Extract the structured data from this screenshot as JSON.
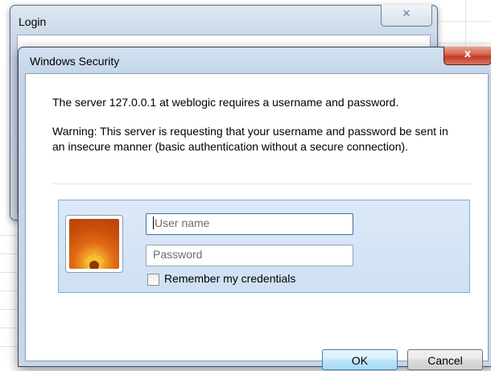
{
  "login_window": {
    "title": "Login",
    "close_glyph": "✕"
  },
  "security_dialog": {
    "title": "Windows Security",
    "close_glyph": "x",
    "message": "The server 127.0.0.1 at weblogic requires a username and password.",
    "warning": "Warning: This server is requesting that your username and password be sent in an insecure manner (basic authentication without a secure connection).",
    "credentials": {
      "avatar_icon": "user-tile-flower-icon",
      "username": {
        "value": "",
        "placeholder": "User name"
      },
      "password": {
        "value": "",
        "placeholder": "Password"
      },
      "remember_label": "Remember my credentials",
      "remember_checked": false
    },
    "buttons": {
      "ok_label": "OK",
      "cancel_label": "Cancel"
    }
  }
}
